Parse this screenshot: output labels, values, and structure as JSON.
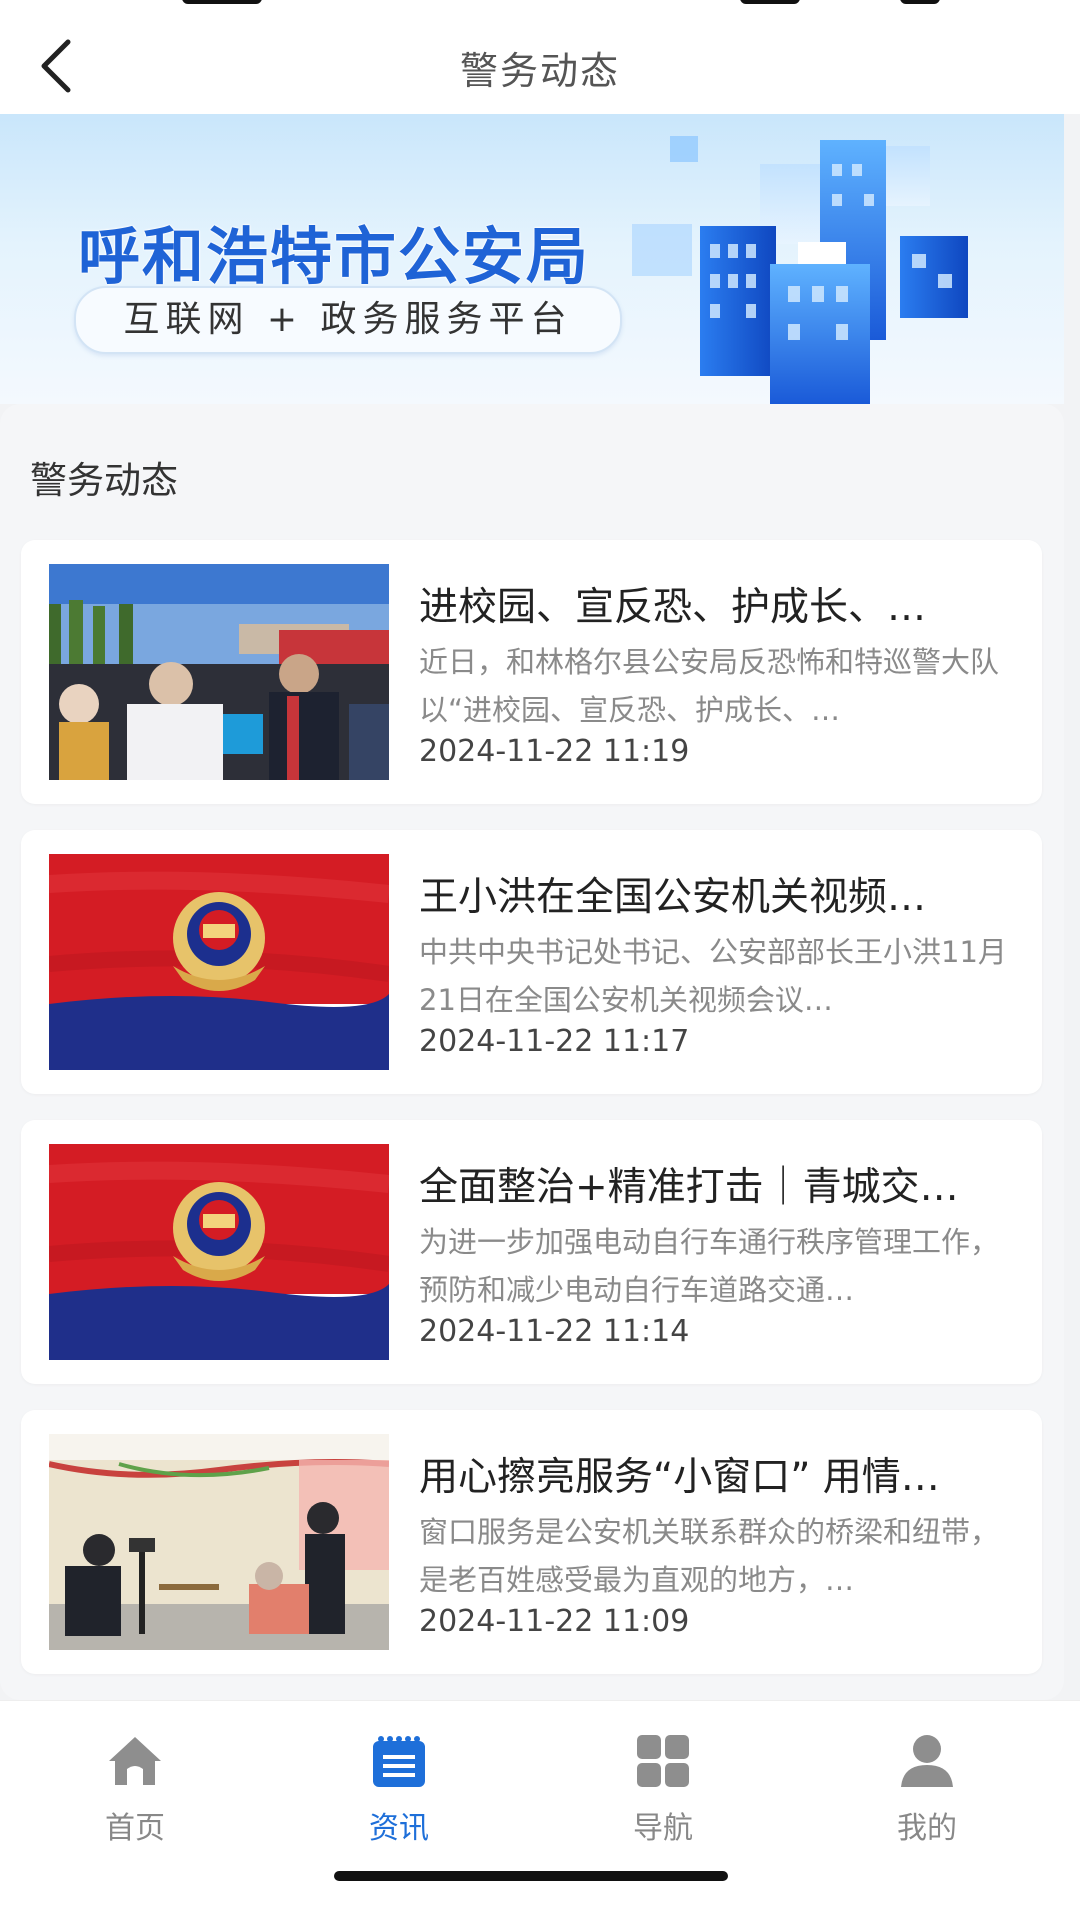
{
  "header": {
    "title": "警务动态",
    "back_icon": "chevron-left-icon"
  },
  "banner": {
    "title": "呼和浩特市公安局",
    "subtitle": "互联网 + 政务服务平台"
  },
  "section": {
    "title": "警务动态"
  },
  "news": [
    {
      "title": "进校园、宣反恐、护成长、…",
      "summary": "近日，和林格尔县公安局反恐怖和特巡警大队以“进校园、宣反恐、护成长、…",
      "time": "2024-11-22 11:19",
      "thumb": "campus-event-photo"
    },
    {
      "title": "王小洪在全国公安机关视频…",
      "summary": "中共中央书记处书记、公安部部长王小洪11月21日在全国公安机关视频会议…",
      "time": "2024-11-22 11:17",
      "thumb": "police-flag-photo"
    },
    {
      "title": "全面整治+精准打击｜青城交…",
      "summary": "为进一步加强电动自行车通行秩序管理工作，预防和减少电动自行车道路交通…",
      "time": "2024-11-22 11:14",
      "thumb": "police-flag-photo"
    },
    {
      "title": "用心擦亮服务“小窗口” 用情…",
      "summary": "窗口服务是公安机关联系群众的桥梁和纽带，是老百姓感受最为直观的地方，…",
      "time": "2024-11-22 11:09",
      "thumb": "service-window-photo"
    }
  ],
  "tabbar": {
    "items": [
      {
        "label": "首页",
        "icon": "home-icon",
        "active": false
      },
      {
        "label": "资讯",
        "icon": "news-icon",
        "active": true
      },
      {
        "label": "导航",
        "icon": "grid-icon",
        "active": false
      },
      {
        "label": "我的",
        "icon": "user-icon",
        "active": false
      }
    ]
  },
  "colors": {
    "accent": "#1e6fd9",
    "inactive": "#888888",
    "banner_title": "#1f63d6"
  }
}
